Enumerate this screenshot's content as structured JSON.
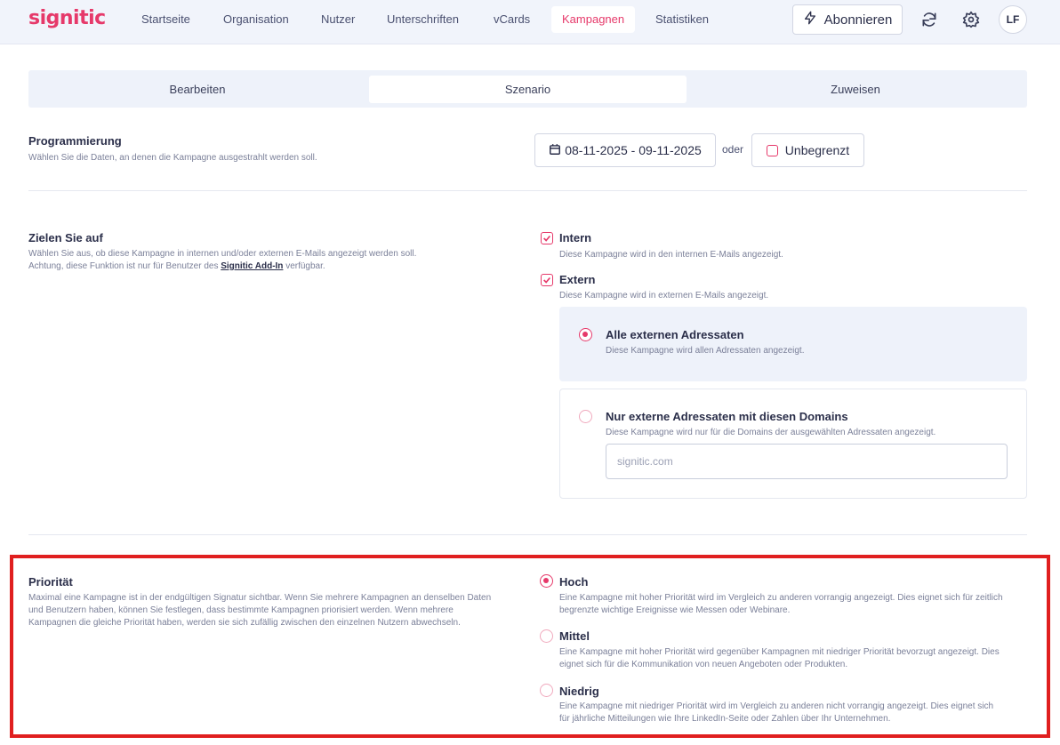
{
  "app": {
    "logo": "signitic"
  },
  "nav": {
    "items": [
      "Startseite",
      "Organisation",
      "Nutzer",
      "Unterschriften",
      "vCards",
      "Kampagnen",
      "Statistiken"
    ],
    "subscribe_label": "Abonnieren",
    "avatar_initials": "LF"
  },
  "tabs": [
    "Bearbeiten",
    "Szenario",
    "Zuweisen"
  ],
  "programming": {
    "title": "Programmierung",
    "desc": "Wählen Sie die Daten, an denen die Kampagne ausgestrahlt werden soll.",
    "date_range": "08-11-2025 - 09-11-2025",
    "or_label": "oder",
    "unlimited_label": "Unbegrenzt"
  },
  "target": {
    "title": "Zielen Sie auf",
    "desc_line1": "Wählen Sie aus, ob diese Kampagne in internen und/oder externen E-Mails angezeigt werden soll.",
    "desc_line2_prefix": "Achtung, diese Funktion ist nur für Benutzer des",
    "desc_link": "Signitic Add-In",
    "desc_line2_suffix": "verfügbar.",
    "intern_label": "Intern",
    "intern_desc": "Diese Kampagne wird in den internen E-Mails angezeigt.",
    "extern_label": "Extern",
    "extern_desc": "Diese Kampagne wird in externen E-Mails angezeigt.",
    "all_external_label": "Alle externen Adressaten",
    "all_external_desc": "Diese Kampagne wird allen Adressaten angezeigt.",
    "domains_label": "Nur externe Adressaten mit diesen Domains",
    "domains_desc": "Diese Kampagne wird nur für die Domains der ausgewählten Adressaten angezeigt.",
    "domains_placeholder": "signitic.com"
  },
  "priority": {
    "title": "Priorität",
    "desc_lines": [
      "Maximal eine Kampagne ist in der endgültigen Signatur sichtbar. Wenn Sie mehrere Kampagnen an denselben Daten",
      "und Benutzern haben, können Sie festlegen, dass bestimmte Kampagnen priorisiert werden. Wenn mehrere",
      "Kampagnen die gleiche Priorität haben, werden sie sich zufällig zwischen den einzelnen Nutzern abwechseln."
    ],
    "high_label": "Hoch",
    "high_desc_lines": [
      "Eine Kampagne mit hoher Priorität wird im Vergleich zu anderen vorrangig angezeigt. Dies eignet sich für zeitlich",
      "begrenzte wichtige Ereignisse wie Messen oder Webinare."
    ],
    "medium_label": "Mittel",
    "medium_desc_lines": [
      "Eine Kampagne mit hoher Priorität wird gegenüber Kampagnen mit niedriger Priorität bevorzugt angezeigt. Dies",
      "eignet sich für die Kommunikation von neuen Angeboten oder Produkten."
    ],
    "low_label": "Niedrig",
    "low_desc_lines": [
      "Eine Kampagne mit niedriger Priorität wird im Vergleich zu anderen nicht vorrangig angezeigt. Dies eignet sich",
      "für jährliche Mitteilungen wie Ihre LinkedIn-Seite oder Zahlen über Ihr Unternehmen."
    ]
  },
  "colors": {
    "brand": "#e6396a",
    "highlight_border": "#e01f1f"
  }
}
